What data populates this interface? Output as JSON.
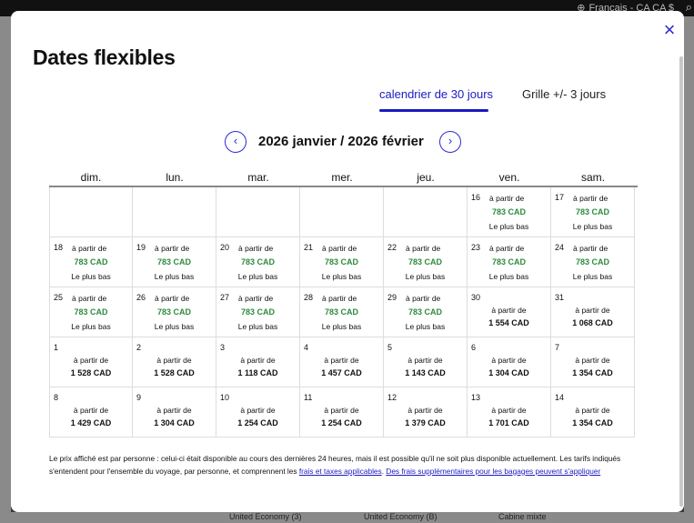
{
  "topbar": {
    "language": "Français - CA CA $"
  },
  "modal": {
    "title": "Dates flexibles",
    "close_label": "×",
    "tabs": [
      {
        "label": "calendrier de 30 jours",
        "active": true
      },
      {
        "label": "Grille +/- 3 jours",
        "active": false
      }
    ],
    "month_title": "2026 janvier / 2026 février",
    "prev_label": "‹",
    "next_label": "›",
    "days_of_week": [
      "dim.",
      "lun.",
      "mar.",
      "mer.",
      "jeu.",
      "ven.",
      "sam."
    ],
    "weeks": [
      [
        null,
        null,
        null,
        null,
        null,
        {
          "day": "16",
          "from": "à partir de",
          "price": "783 CAD",
          "tag": "Le plus bas"
        },
        {
          "day": "17",
          "from": "à partir de",
          "price": "783 CAD",
          "tag": "Le plus bas"
        }
      ],
      [
        {
          "day": "18",
          "from": "à partir de",
          "price": "783 CAD",
          "tag": "Le plus bas"
        },
        {
          "day": "19",
          "from": "à partir de",
          "price": "783 CAD",
          "tag": "Le plus bas"
        },
        {
          "day": "20",
          "from": "à partir de",
          "price": "783 CAD",
          "tag": "Le plus bas"
        },
        {
          "day": "21",
          "from": "à partir de",
          "price": "783 CAD",
          "tag": "Le plus bas"
        },
        {
          "day": "22",
          "from": "à partir de",
          "price": "783 CAD",
          "tag": "Le plus bas"
        },
        {
          "day": "23",
          "from": "à partir de",
          "price": "783 CAD",
          "tag": "Le plus bas"
        },
        {
          "day": "24",
          "from": "à partir de",
          "price": "783 CAD",
          "tag": "Le plus bas"
        }
      ],
      [
        {
          "day": "25",
          "from": "à partir de",
          "price": "783 CAD",
          "tag": "Le plus bas"
        },
        {
          "day": "26",
          "from": "à partir de",
          "price": "783 CAD",
          "tag": "Le plus bas"
        },
        {
          "day": "27",
          "from": "à partir de",
          "price": "783 CAD",
          "tag": "Le plus bas"
        },
        {
          "day": "28",
          "from": "à partir de",
          "price": "783 CAD",
          "tag": "Le plus bas"
        },
        {
          "day": "29",
          "from": "à partir de",
          "price": "783 CAD",
          "tag": "Le plus bas"
        },
        {
          "day": "30",
          "from": "à partir de",
          "price": "1 554 CAD"
        },
        {
          "day": "31",
          "from": "à partir de",
          "price": "1 068 CAD"
        }
      ],
      [
        {
          "day": "1",
          "from": "à partir de",
          "price": "1 528 CAD"
        },
        {
          "day": "2",
          "from": "à partir de",
          "price": "1 528 CAD"
        },
        {
          "day": "3",
          "from": "à partir de",
          "price": "1 118 CAD"
        },
        {
          "day": "4",
          "from": "à partir de",
          "price": "1 457 CAD"
        },
        {
          "day": "5",
          "from": "à partir de",
          "price": "1 143 CAD"
        },
        {
          "day": "6",
          "from": "à partir de",
          "price": "1 304 CAD"
        },
        {
          "day": "7",
          "from": "à partir de",
          "price": "1 354 CAD"
        }
      ],
      [
        {
          "day": "8",
          "from": "à partir de",
          "price": "1 429 CAD"
        },
        {
          "day": "9",
          "from": "à partir de",
          "price": "1 304 CAD"
        },
        {
          "day": "10",
          "from": "à partir de",
          "price": "1 254 CAD"
        },
        {
          "day": "11",
          "from": "à partir de",
          "price": "1 254 CAD"
        },
        {
          "day": "12",
          "from": "à partir de",
          "price": "1 379 CAD"
        },
        {
          "day": "13",
          "from": "à partir de",
          "price": "1 701 CAD"
        },
        {
          "day": "14",
          "from": "à partir de",
          "price": "1 354 CAD"
        }
      ]
    ],
    "disclaimer": {
      "text": "Le prix affiché est par personne : celui-ci était disponible au cours des dernières 24 heures, mais il est possible qu'il ne soit plus disponible actuellement. Les tarifs indiqués s'entendent pour l'ensemble du voyage, par personne, et comprennent les ",
      "link1": "frais et taxes applicables",
      "sep": ". ",
      "link2": "Des frais supplémentaires pour les bagages peuvent s'appliquer"
    }
  },
  "background": {
    "bottom_labels": [
      "United Economy (3)",
      "United Economy (B)",
      "Cabine mixte"
    ]
  },
  "colors": {
    "accent": "#1a1ac0",
    "price_green": "#2e8a3e"
  }
}
